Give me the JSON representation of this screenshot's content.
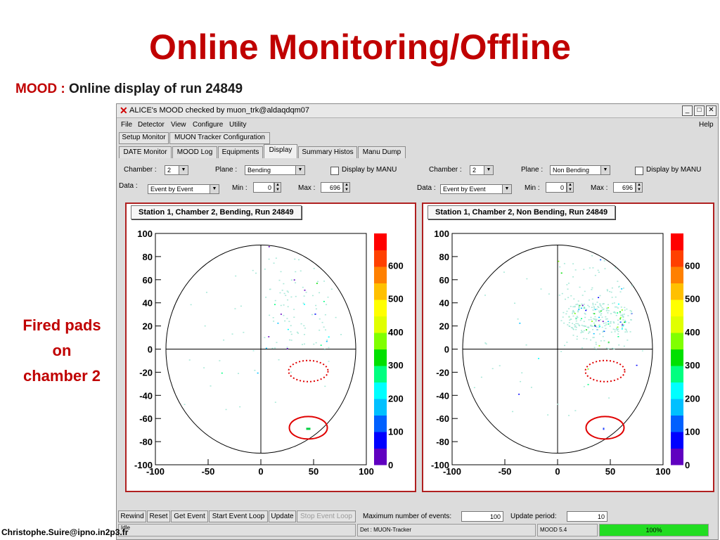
{
  "slide": {
    "title": "Online Monitoring/Offline",
    "subtitle_prefix": "MOOD : ",
    "subtitle_text": "Online display of run 24849",
    "side_label_lines": [
      "Fired pads",
      "on",
      "chamber 2"
    ],
    "footer": "Christophe.Suire@ipno.in2p3.fr"
  },
  "window": {
    "title": "ALICE's MOOD checked by muon_trk@aldaqdqm07",
    "controls": {
      "minimize": "_",
      "maximize": "□",
      "close": "✕"
    },
    "menu": [
      "File",
      "Detector",
      "View",
      "Configure",
      "Utility"
    ],
    "help": "Help",
    "top_buttons": [
      "Setup Monitor",
      "MUON Tracker Configuration"
    ],
    "tabs": [
      "DATE Monitor",
      "MOOD Log",
      "Equipments",
      "Display",
      "Summary Histos",
      "Manu Dump"
    ],
    "active_tab": "Display",
    "left_controls": {
      "chamber_label": "Chamber :",
      "chamber_value": "2",
      "plane_label": "Plane :",
      "plane_value": "Bending",
      "manu_label": "Display by MANU",
      "data_label": "Data :",
      "data_value": "Event by Event",
      "min_label": "Min :",
      "min_value": "0",
      "max_label": "Max :",
      "max_value": "696"
    },
    "right_controls": {
      "chamber_label": "Chamber :",
      "chamber_value": "2",
      "plane_label": "Plane :",
      "plane_value": "Non Bending",
      "manu_label": "Display by MANU",
      "data_label": "Data :",
      "data_value": "Event by Event",
      "min_label": "Min :",
      "min_value": "0",
      "max_label": "Max :",
      "max_value": "696"
    },
    "bottom_buttons": [
      "Rewind",
      "Reset",
      "Get Event",
      "Start Event Loop",
      "Update",
      "Stop Event Loop"
    ],
    "max_events_label": "Maximum number of events:",
    "max_events_value": "100",
    "update_period_label": "Update period:",
    "update_period_value": "10",
    "status": {
      "left": "Idle",
      "det": "Det : MUON-Tracker",
      "version": "MOOD 5.4",
      "progress_text": "100%",
      "progress": 1.0
    },
    "colors": {
      "accent": "#c00000",
      "progress": "#22dd22"
    }
  },
  "plots": [
    {
      "title": "Station 1, Chamber 2, Bending, Run 24849",
      "x_ticks": [
        "-100",
        "-50",
        "0",
        "50",
        "100"
      ],
      "y_ticks": [
        "100",
        "80",
        "60",
        "40",
        "20",
        "0",
        "-20",
        "-40",
        "-60",
        "-80",
        "-100"
      ],
      "z_ticks": [
        "600",
        "500",
        "400",
        "300",
        "200",
        "100",
        "0"
      ]
    },
    {
      "title": "Station 1, Chamber 2, Non Bending, Run 24849",
      "x_ticks": [
        "-100",
        "-50",
        "0",
        "50",
        "100"
      ],
      "y_ticks": [
        "100",
        "80",
        "60",
        "40",
        "20",
        "0",
        "-20",
        "-40",
        "-60",
        "-80",
        "-100"
      ],
      "z_ticks": [
        "600",
        "500",
        "400",
        "300",
        "200",
        "100",
        "0"
      ]
    }
  ]
}
